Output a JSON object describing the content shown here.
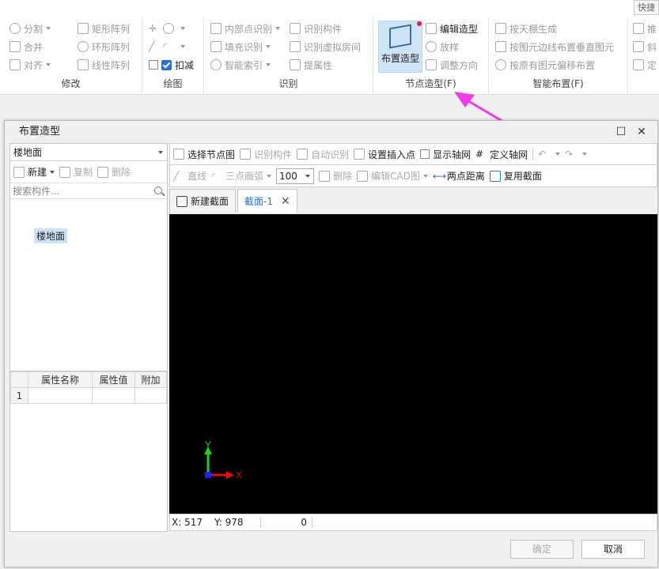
{
  "quick_access": "快捷",
  "ribbon": {
    "groups": [
      {
        "title": "修改",
        "items": [
          "分割",
          "矩形阵列",
          "合并",
          "环形阵列",
          "对齐",
          "线性阵列"
        ]
      },
      {
        "title": "绘图",
        "items": [
          "扣减"
        ]
      },
      {
        "title": "识别",
        "items": [
          "内部点识别",
          "识别构件",
          "填充识别",
          "识别虚拟房间",
          "智能索引",
          "提属性"
        ]
      },
      {
        "title": "节点造型(F)",
        "big_button": "布置造型",
        "items": [
          "编辑造型",
          "放样",
          "调整方向"
        ]
      },
      {
        "title": "智能布置(F)",
        "items": [
          "按天棚生成",
          "按图元边线布置垂直图元",
          "按原有图元偏移布置"
        ]
      }
    ],
    "right_cut": [
      "推",
      "斜",
      "定"
    ]
  },
  "dialog": {
    "title": "布置造型",
    "left": {
      "combo": "楼地面",
      "new": "新建",
      "copy": "复制",
      "delete": "删除",
      "search_placeholder": "搜索构件...",
      "tree_item": "楼地面",
      "props_headers": [
        "属性名称",
        "属性值",
        "附加"
      ],
      "props_rows": [
        [
          "1",
          "",
          "",
          ""
        ]
      ]
    },
    "toolbar1": [
      "选择节点图",
      "识别构件",
      "自动识别",
      "设置插入点",
      "显示轴网",
      "定义轴网"
    ],
    "toolbar2": [
      "直线",
      "三点画弧",
      "100",
      "删除",
      "编辑CAD图",
      "两点距离",
      "复用截面"
    ],
    "tabs": [
      "新建截面",
      "截面-1"
    ],
    "axis": {
      "x": "X",
      "y": "Y"
    },
    "status": {
      "x": "X: 517",
      "y": "Y: 978",
      "value": "0"
    },
    "ok": "确定",
    "cancel": "取消"
  },
  "colors": {
    "accent": "#2a6fd6",
    "arrow": "#f03ce8",
    "canvas": "#000000"
  }
}
